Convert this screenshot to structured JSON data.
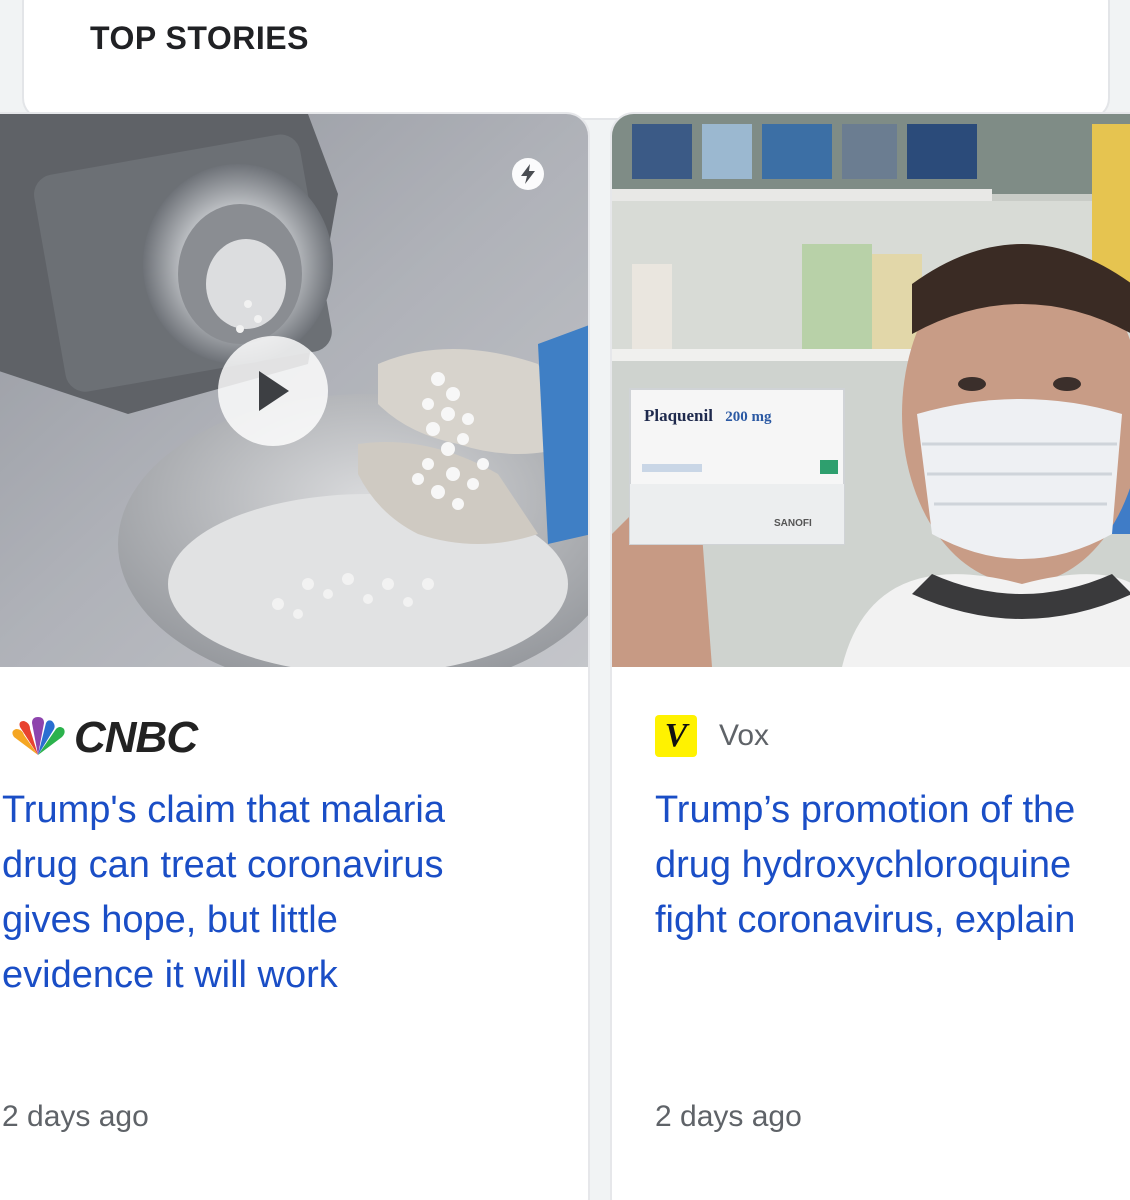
{
  "top_stories": {
    "title": "TOP STORIES"
  },
  "cards": [
    {
      "source": "CNBC",
      "headline_lines": [
        "Trump's claim that malaria",
        "drug can treat coronavirus",
        "gives hope, but little",
        "evidence it will work"
      ],
      "timestamp": "2 days ago",
      "icons": [
        "amp-lightning-icon",
        "play-icon",
        "cnbc-peacock-icon"
      ]
    },
    {
      "source": "Vox",
      "source_badge": "V",
      "headline_lines": [
        "Trump’s promotion of the",
        "drug hydroxychloroquine",
        "fight coronavirus, explain"
      ],
      "timestamp": "2 days ago",
      "image_text": {
        "box_brand": "Plaquenil",
        "box_dose": "200 mg",
        "box_maker": "SANOFI"
      }
    }
  ],
  "colors": {
    "headline": "#1a4ec6",
    "meta": "#5f6368",
    "vox_yellow": "#fff200"
  }
}
